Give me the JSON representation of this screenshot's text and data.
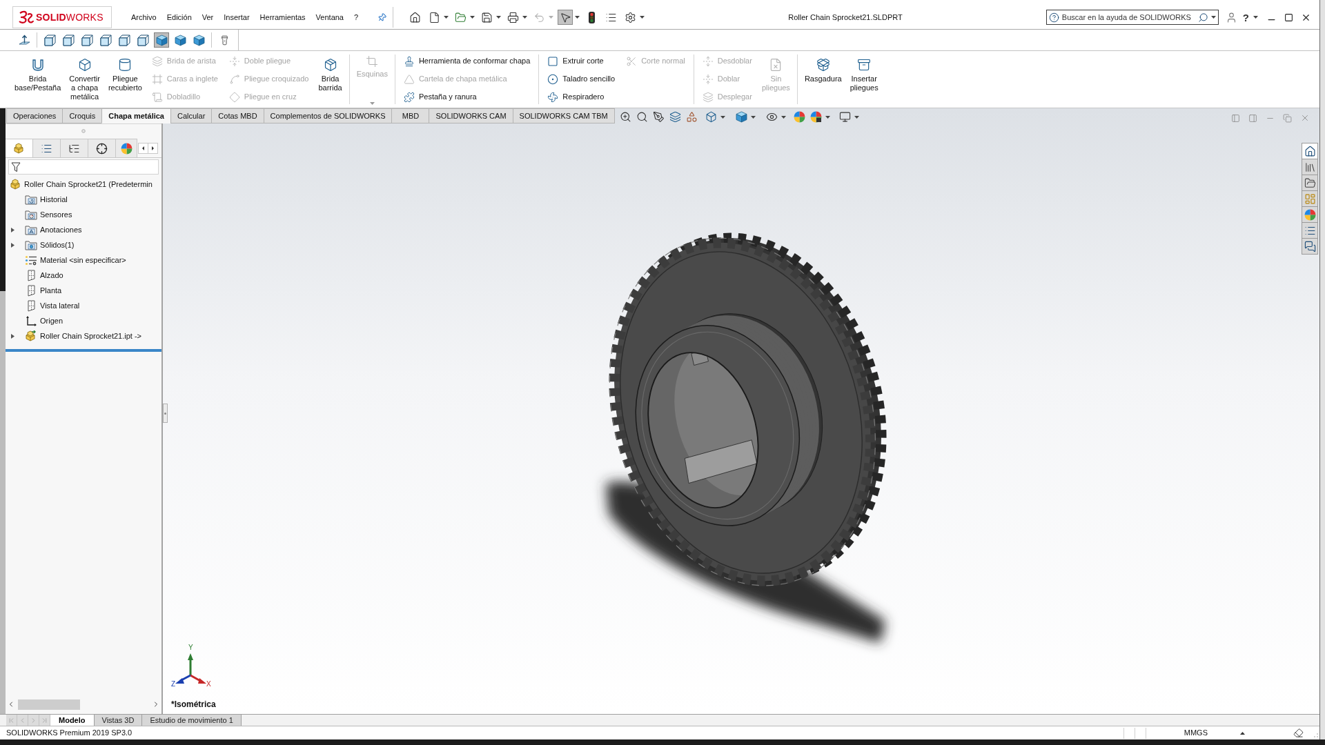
{
  "title_bar": {
    "logo": "**SOLID**WORKS",
    "menus": [
      "Archivo",
      "Edición",
      "Ver",
      "Insertar",
      "Herramientas",
      "Ventana",
      "?"
    ],
    "quick_access": [
      {
        "kind": "home",
        "dropdown": false,
        "disabled": false,
        "pressed": false
      },
      {
        "kind": "new",
        "dropdown": true,
        "disabled": false,
        "pressed": false
      },
      {
        "kind": "open",
        "dropdown": true,
        "disabled": false,
        "pressed": false
      },
      {
        "kind": "save",
        "dropdown": true,
        "disabled": false,
        "pressed": false
      },
      {
        "kind": "print",
        "dropdown": true,
        "disabled": false,
        "pressed": false
      },
      {
        "kind": "undo",
        "dropdown": true,
        "disabled": true,
        "pressed": false
      },
      {
        "kind": "select",
        "dropdown": true,
        "disabled": false,
        "pressed": true
      },
      {
        "kind": "rebuild",
        "dropdown": false,
        "disabled": false,
        "pressed": false
      },
      {
        "kind": "properties",
        "dropdown": false,
        "disabled": false,
        "pressed": false
      },
      {
        "kind": "options",
        "dropdown": true,
        "disabled": false,
        "pressed": false
      }
    ],
    "document_title": "Roller Chain Sprocket21.SLDPRT",
    "search": {
      "placeholder": "Buscar en la ayuda de SOLIDWORKS"
    },
    "help_label": "?"
  },
  "view_toolbar": [
    {
      "kind": "normal-to",
      "selected": false
    },
    {
      "kind": "wireframe",
      "selected": false
    },
    {
      "kind": "wireframe",
      "selected": false
    },
    {
      "kind": "wireframe",
      "selected": false
    },
    {
      "kind": "wireframe",
      "selected": false
    },
    {
      "kind": "wireframe",
      "selected": false
    },
    {
      "kind": "wireframe",
      "selected": false
    },
    {
      "kind": "shaded",
      "selected": true
    },
    {
      "kind": "shaded",
      "selected": false
    },
    {
      "kind": "shaded",
      "selected": false
    },
    {
      "kind": "tool",
      "selected": false
    }
  ],
  "command_manager": {
    "groups": [
      {
        "buttons": [
          {
            "kind": "large",
            "lines": [
              "Brida",
              "base/Pestaña"
            ],
            "disabled": false
          },
          {
            "kind": "large",
            "lines": [
              "Convertir",
              "a chapa",
              "metálica"
            ],
            "disabled": false
          },
          {
            "kind": "large",
            "lines": [
              "Pliegue",
              "recubierto"
            ],
            "disabled": false
          },
          {
            "kind": "small",
            "lines": [
              "Brida de arista"
            ],
            "disabled": true
          },
          {
            "kind": "small",
            "lines": [
              "Caras a inglete"
            ],
            "disabled": true
          },
          {
            "kind": "small",
            "lines": [
              "Dobladillo"
            ],
            "disabled": true
          },
          {
            "kind": "small",
            "lines": [
              "Doble pliegue"
            ],
            "disabled": true
          },
          {
            "kind": "small",
            "lines": [
              "Pliegue croquizado"
            ],
            "disabled": true
          },
          {
            "kind": "small",
            "lines": [
              "Pliegue en cruz"
            ],
            "disabled": true
          },
          {
            "kind": "large",
            "lines": [
              "Brida",
              "barrida"
            ],
            "disabled": false
          }
        ]
      },
      {
        "buttons": [
          {
            "kind": "flyout",
            "lines": [
              "Esquinas"
            ],
            "disabled": true
          }
        ]
      },
      {
        "buttons": [
          {
            "kind": "small",
            "lines": [
              "Herramienta de conformar chapa"
            ],
            "disabled": false
          },
          {
            "kind": "small",
            "lines": [
              "Cartela de chapa metálica"
            ],
            "disabled": true
          },
          {
            "kind": "small",
            "lines": [
              "Pestaña y ranura"
            ],
            "disabled": false
          }
        ]
      },
      {
        "buttons": [
          {
            "kind": "small",
            "lines": [
              "Extruir corte"
            ],
            "disabled": false
          },
          {
            "kind": "small",
            "lines": [
              "Taladro sencillo"
            ],
            "disabled": false
          },
          {
            "kind": "small",
            "lines": [
              "Respiradero"
            ],
            "disabled": false
          },
          {
            "kind": "small",
            "lines": [
              "Corte normal"
            ],
            "disabled": true
          }
        ]
      },
      {
        "buttons": [
          {
            "kind": "small",
            "lines": [
              "Desdoblar"
            ],
            "disabled": true
          },
          {
            "kind": "small",
            "lines": [
              "Doblar"
            ],
            "disabled": true
          },
          {
            "kind": "small",
            "lines": [
              "Desplegar"
            ],
            "disabled": true
          },
          {
            "kind": "large",
            "lines": [
              "Sin",
              "pliegues"
            ],
            "disabled": true
          }
        ]
      },
      {
        "buttons": [
          {
            "kind": "large",
            "lines": [
              "Rasgadura"
            ],
            "disabled": false
          },
          {
            "kind": "large",
            "lines": [
              "Insertar",
              "pliegues"
            ],
            "disabled": false
          }
        ]
      }
    ]
  },
  "command_tabs": [
    {
      "label": "Operaciones",
      "selected": false
    },
    {
      "label": "Croquis",
      "selected": false
    },
    {
      "label": "Chapa metálica",
      "selected": true
    },
    {
      "label": "Calcular",
      "selected": false
    },
    {
      "label": "Cotas MBD",
      "selected": false
    },
    {
      "label": "Complementos de SOLIDWORKS",
      "selected": false
    },
    {
      "label": "MBD",
      "selected": false
    },
    {
      "label": "SOLIDWORKS CAM",
      "selected": false
    },
    {
      "label": "SOLIDWORKS CAM TBM",
      "selected": false
    }
  ],
  "feature_panel": {
    "tabs": [
      {
        "kind": "feature-tree",
        "selected": true
      },
      {
        "kind": "properties",
        "selected": false
      },
      {
        "kind": "configurations",
        "selected": false
      },
      {
        "kind": "dimxpert",
        "selected": false
      },
      {
        "kind": "display",
        "selected": false
      }
    ],
    "tree": {
      "kind": "part",
      "label": "Roller Chain Sprocket21 (Predetermin",
      "children": [
        {
          "kind": "history",
          "label": "Historial"
        },
        {
          "kind": "sensors",
          "label": "Sensores"
        },
        {
          "kind": "annotations",
          "label": "Anotaciones",
          "expanded": false
        },
        {
          "kind": "solids",
          "label": "Sólidos(1)",
          "expanded": false
        },
        {
          "kind": "material",
          "label": "Material <sin especificar>"
        },
        {
          "kind": "plane",
          "label": "Alzado"
        },
        {
          "kind": "plane",
          "label": "Planta"
        },
        {
          "kind": "plane",
          "label": "Vista lateral"
        },
        {
          "kind": "origin",
          "label": "Origen"
        },
        {
          "kind": "linked-part",
          "label": "Roller Chain Sprocket21.ipt ->",
          "expanded": false
        }
      ]
    }
  },
  "graphics": {
    "view_name": "*Isométrica",
    "triad": {
      "x": "X",
      "y": "Y",
      "z": "Z"
    },
    "task_pane": [
      {
        "kind": "home",
        "selected": true
      },
      {
        "kind": "library",
        "selected": false
      },
      {
        "kind": "explorer",
        "selected": false
      },
      {
        "kind": "view-palette",
        "selected": false
      },
      {
        "kind": "appearances",
        "selected": false
      },
      {
        "kind": "properties",
        "selected": false
      },
      {
        "kind": "forum",
        "selected": false
      }
    ]
  },
  "bottom_tabs": [
    {
      "label": "Modelo",
      "selected": true
    },
    {
      "label": "Vistas 3D",
      "selected": false
    },
    {
      "label": "Estudio de movimiento 1",
      "selected": false
    }
  ],
  "status_bar": {
    "product": "SOLIDWORKS Premium 2019 SP3.0",
    "units": "MMGS"
  }
}
